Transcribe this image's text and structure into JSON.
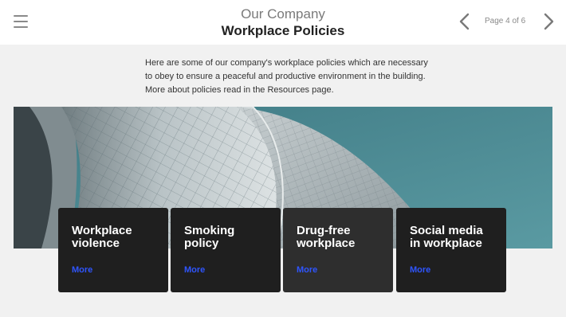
{
  "header": {
    "subtitle": "Our Company",
    "title": "Workplace Policies",
    "page_indicator": "Page 4 of 6"
  },
  "intro": {
    "line1": "Here are some of our company's workplace policies which are necessary",
    "line2": "to obey to ensure a peaceful and productive environment in the building.",
    "line3": "More about policies read in the Resources page."
  },
  "cards": [
    {
      "line1": "Workplace",
      "line2": "violence",
      "more": "More"
    },
    {
      "line1": "Smoking",
      "line2": "policy",
      "more": "More"
    },
    {
      "line1": "Drug-free",
      "line2": "workplace",
      "more": "More"
    },
    {
      "line1": "Social media",
      "line2": "in workplace",
      "more": "More"
    }
  ],
  "colors": {
    "accent": "#2f55ff",
    "card_bg": "#1f1f1f",
    "banner_sky": "#4f8e96"
  }
}
